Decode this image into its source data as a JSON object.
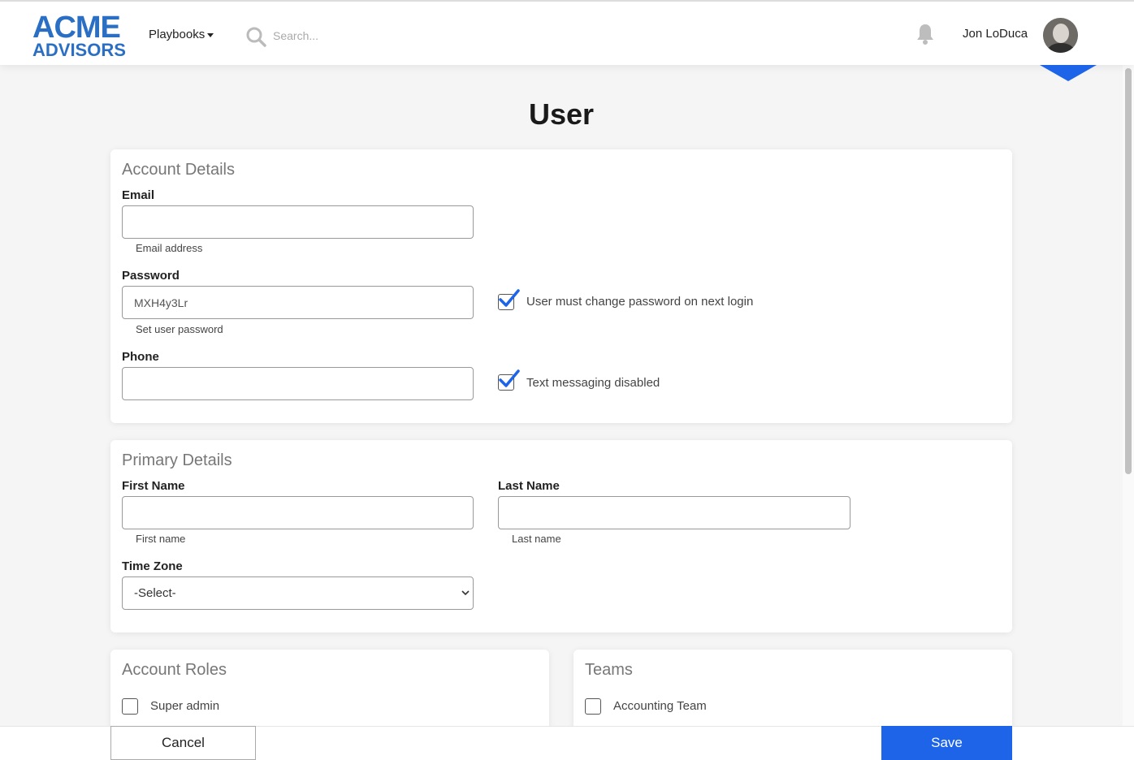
{
  "header": {
    "logo_line1": "ACME",
    "logo_line2": "ADVISORS",
    "nav_playbooks": "Playbooks",
    "search_placeholder": "Search...",
    "user_name": "Jon LoDuca"
  },
  "page": {
    "title": "User"
  },
  "account_details": {
    "title": "Account Details",
    "email_label": "Email",
    "email_value": "",
    "email_hint": "Email address",
    "password_label": "Password",
    "password_value": "MXH4y3Lr",
    "password_hint": "Set user password",
    "must_change_label": "User must change password on next login",
    "must_change_checked": true,
    "phone_label": "Phone",
    "phone_value": "",
    "text_disabled_label": "Text messaging disabled",
    "text_disabled_checked": true
  },
  "primary_details": {
    "title": "Primary Details",
    "first_name_label": "First Name",
    "first_name_hint": "First name",
    "last_name_label": "Last Name",
    "last_name_hint": "Last name",
    "time_zone_label": "Time Zone",
    "time_zone_value": "-Select-"
  },
  "account_roles": {
    "title": "Account Roles",
    "items": [
      {
        "label": "Super admin",
        "checked": false
      }
    ]
  },
  "teams": {
    "title": "Teams",
    "items": [
      {
        "label": "Accounting Team",
        "checked": false
      }
    ]
  },
  "footer": {
    "cancel_label": "Cancel",
    "save_label": "Save"
  },
  "colors": {
    "accent": "#1d64e8",
    "logo": "#2a6fc4"
  }
}
